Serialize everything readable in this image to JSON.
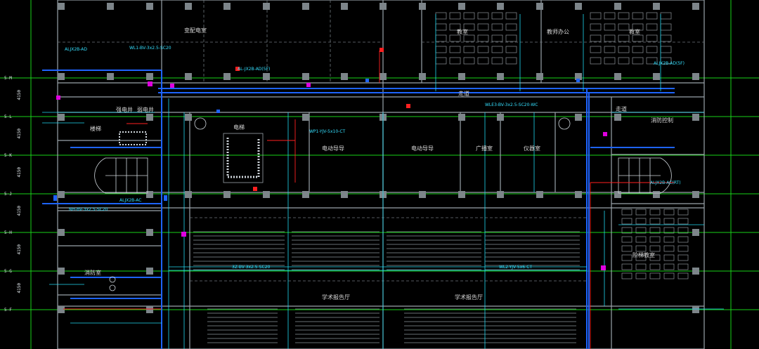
{
  "drawing": {
    "rooms": {
      "power_room": "变配电室",
      "office": "教师办公",
      "classroom_left": "教室",
      "classroom_right": "教室",
      "stair": "楼梯",
      "lift": "电梯",
      "shaft": "强电井",
      "weak_shaft": "弱电井",
      "control_room": "消防控制",
      "guide_left": "电动导导",
      "guide_mid": "电动导导",
      "broadcast": "广播室",
      "instrument": "仪器室",
      "lobby": "阶梯教室",
      "hall_left": "学术报告厅",
      "hall_right": "学术报告厅",
      "corridor": "走道",
      "fire_room": "消防室"
    },
    "axis_labels": [
      "5-M",
      "5-L",
      "5-K",
      "5-J",
      "5-H",
      "5-G",
      "5-F"
    ],
    "dimensions": [
      "4150",
      "4150",
      "4150",
      "4150",
      "4150",
      "4150"
    ],
    "notes": {
      "n1": "ALJX2B-AD",
      "n2": "WL1-BV-3x2.5-SC20",
      "n3": "AL-JX2B-AD(5F)",
      "n4": "ALJX2B-AC",
      "n5": "NH-BV-3x2.5-SC20",
      "n6": "WLE3-BV-3x2.5-SC20-WC",
      "n7": "WP1-YJV-5x10-CT",
      "n8": "ALJX2B-AD(5F)",
      "n9": "3Z-BV-3x2.5-SC20",
      "n10": "WL2-YJV-5x6-CT",
      "n11": "ALJX2B-AC(RT)"
    },
    "colors": {
      "background": "#000000",
      "wall": "#9aa3aa",
      "grid": "#19d219",
      "duct": "#1e64ff",
      "cyan": "#20d8f0",
      "red": "#ff2020",
      "magenta": "#e000e0",
      "white": "#dfe6ea"
    }
  }
}
